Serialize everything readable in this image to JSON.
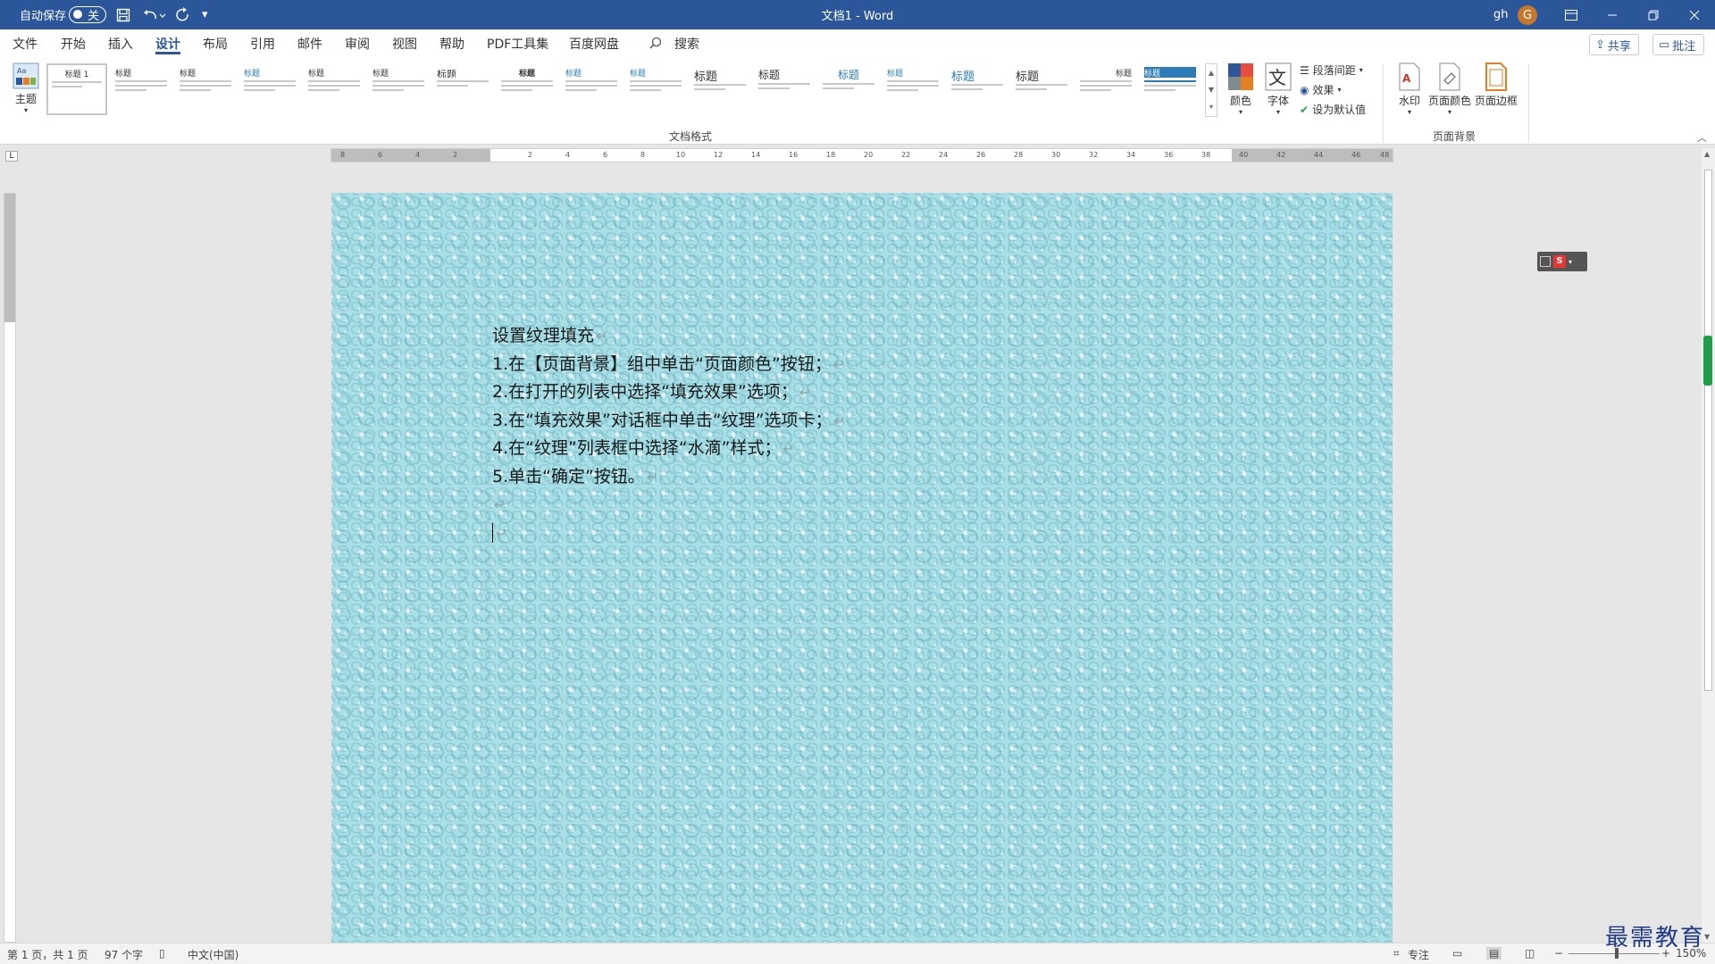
{
  "titlebar": {
    "autosave_label": "自动保存",
    "autosave_state": "关",
    "doc_title": "文档1 - Word",
    "user_name": "gh",
    "user_initial": "G"
  },
  "menu": {
    "tabs": [
      "文件",
      "开始",
      "插入",
      "设计",
      "布局",
      "引用",
      "邮件",
      "审阅",
      "视图",
      "帮助",
      "PDF工具集",
      "百度网盘"
    ],
    "active_tab": "设计",
    "search_label": "搜索",
    "share_label": "共享",
    "comment_label": "批注"
  },
  "ribbon": {
    "theme_label": "主题",
    "document_format_group": "文档格式",
    "style_thumb_titles": [
      "标题 1",
      "标题",
      "标题",
      "标题",
      "标题",
      "标题",
      "标题",
      "标题",
      "标题",
      "标题",
      "标题",
      "标题",
      "标题",
      "标题",
      "标题",
      "标题",
      "标题",
      "标题"
    ],
    "colors_label": "颜色",
    "fonts_label": "字体",
    "paragraph_spacing_label": "段落间距",
    "effects_label": "效果",
    "set_default_label": "设为默认值",
    "watermark_label": "水印",
    "page_color_label": "页面颜色",
    "page_border_label": "页面边框",
    "page_background_group": "页面背景"
  },
  "ruler": {
    "h_ticks": [
      "8",
      "6",
      "4",
      "2",
      "2",
      "4",
      "6",
      "8",
      "10",
      "12",
      "14",
      "16",
      "18",
      "20",
      "22",
      "24",
      "26",
      "28",
      "30",
      "32",
      "34",
      "36",
      "38",
      "40",
      "42",
      "44",
      "46",
      "48"
    ],
    "corner": "L"
  },
  "document": {
    "lines": [
      "设置纹理填充",
      "1.在【页面背景】组中单击“页面颜色”按钮；",
      "2.在打开的列表中选择“填充效果”选项；",
      "3.在“填充效果”对话框中单击“纹理”选项卡；",
      "4.在“纹理”列表框中选择“水滴”样式；",
      "5.单击“确定”按钮。",
      "",
      ""
    ],
    "paragraph_mark": "↵",
    "texture_color": "#a9dfe6"
  },
  "statusbar": {
    "page_info": "第 1 页，共 1 页",
    "word_count": "97 个字",
    "language": "中文(中国)",
    "focus_label": "专注",
    "zoom_out": "−",
    "zoom_in": "+",
    "zoom_level": "150%"
  },
  "brand_watermark": "最需教育",
  "colors": {
    "title_bar": "#2b579a",
    "accent": "#2b579a"
  }
}
